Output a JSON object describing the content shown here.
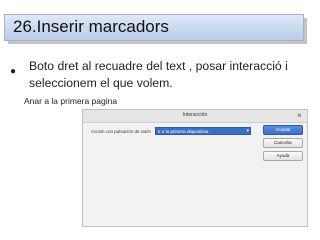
{
  "slide": {
    "title": "26.Inserir marcadors",
    "bullet": "Boto dret al recuadre del text , posar interacció i seleccionem el que volem.",
    "caption": "Anar a la primera pagina"
  },
  "dialog": {
    "title": "Interacción",
    "action_label": "Acción con pulsación de ratón",
    "action_value": "Ir a la primera diapositiva",
    "buttons": {
      "accept": "Aceptar",
      "cancel": "Cancelar",
      "help": "Ayuda"
    }
  },
  "colors": {
    "title_bar": "#c9d8ef",
    "selection": "#3b6fc4"
  }
}
